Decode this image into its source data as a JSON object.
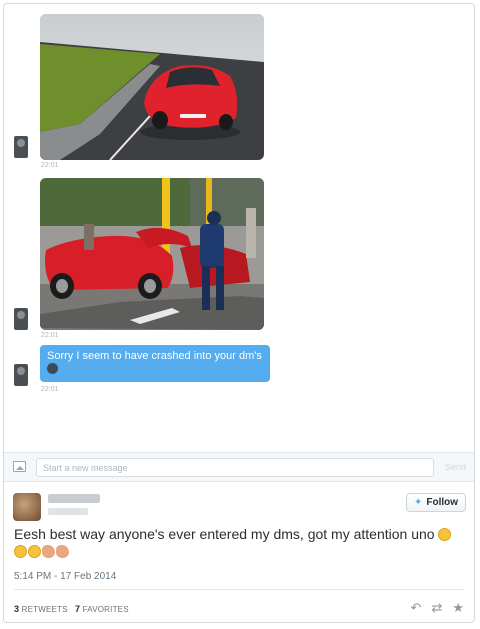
{
  "messages": [
    {
      "type": "photo",
      "description": "red sports car on track",
      "time": "22:01"
    },
    {
      "type": "photo",
      "description": "crashed red sports car",
      "time": "22:01"
    },
    {
      "type": "text",
      "text": "Sorry I seem to have crashed into your dm's",
      "time": "22:01"
    }
  ],
  "compose": {
    "placeholder": "Start a new message",
    "send_label": "Send"
  },
  "tweet": {
    "follow_label": "Follow",
    "text": "Eesh best way anyone's ever entered my dms, got my attention uno",
    "emojis": [
      "laughing-face",
      "laughing-face",
      "laughing-face",
      "clapping-hands",
      "clapping-hands"
    ],
    "date": "5:14 PM - 17 Feb 2014",
    "retweets_count": "3",
    "retweets_label": "RETWEETS",
    "favorites_count": "7",
    "favorites_label": "FAVORITES"
  },
  "colors": {
    "accent": "#55acee",
    "text": "#292f33",
    "muted": "#66757f",
    "car_red": "#e0222c"
  }
}
